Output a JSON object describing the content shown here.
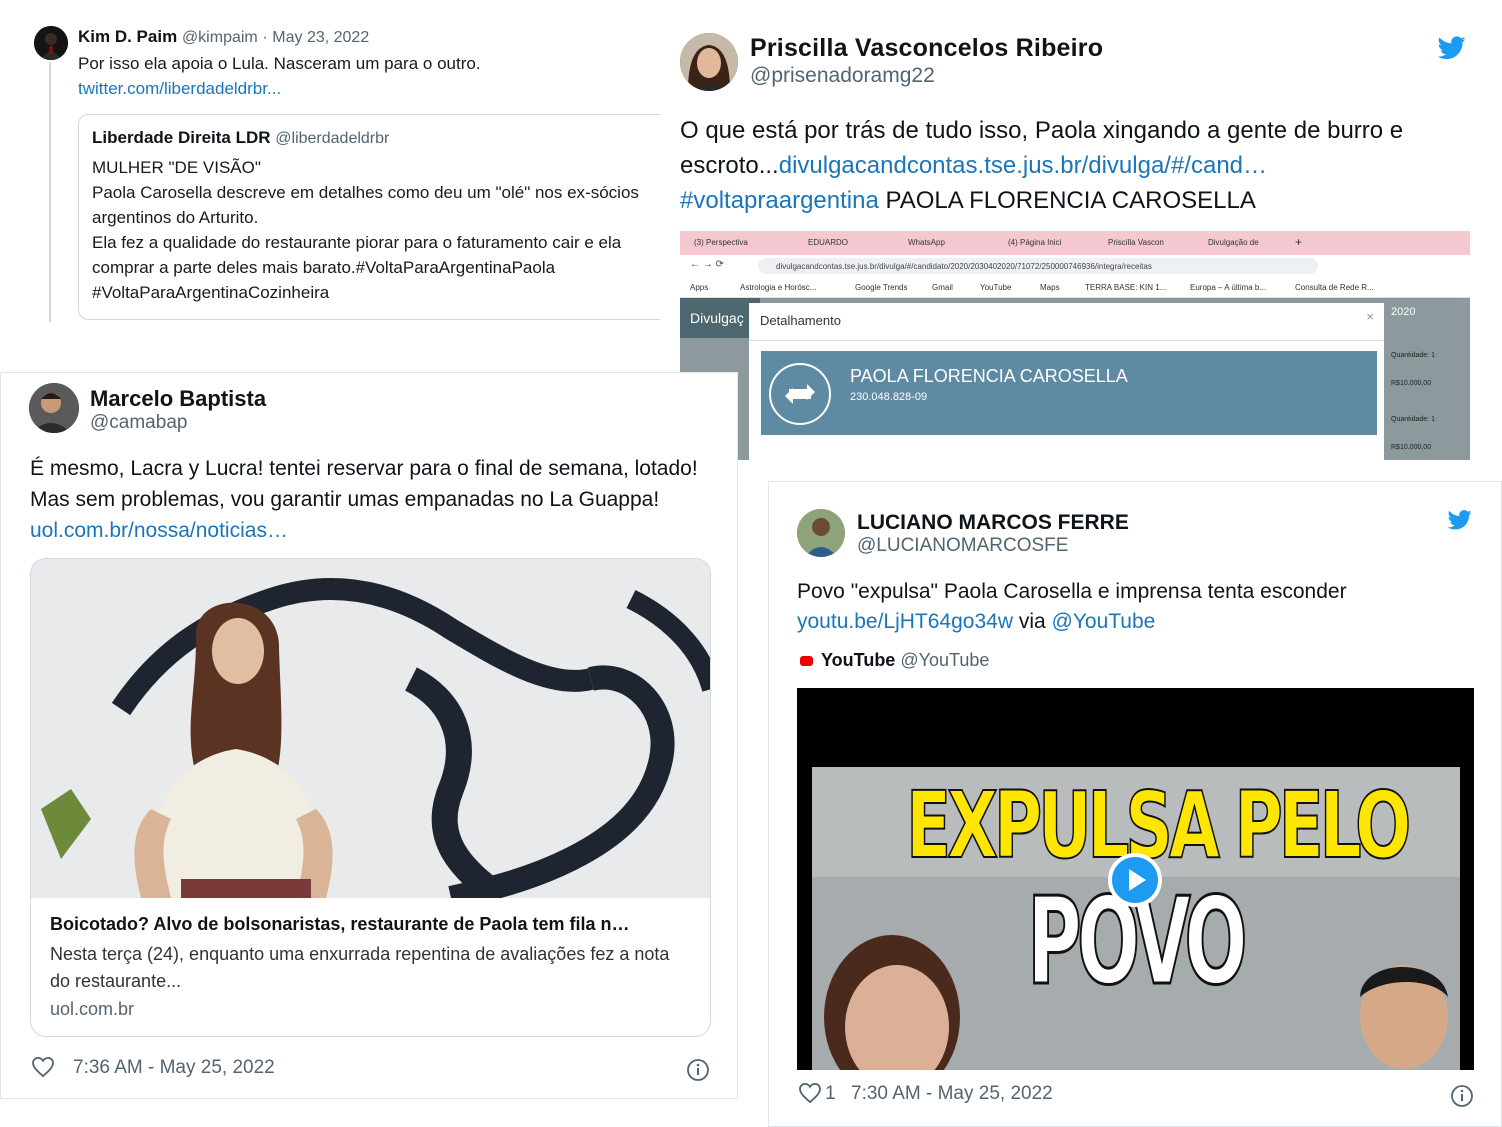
{
  "colors": {
    "link": "#1b75bb",
    "twitter_blue": "#1d9bf0",
    "muted": "#536471",
    "youtube_red": "#ee0000"
  },
  "tweet1": {
    "name": "Kim D. Paim",
    "handle": "@kimpaim",
    "date": "May 23, 2022",
    "text": "Por isso ela apoia o Lula. Nasceram um para o outro.",
    "link": "twitter.com/liberdadeldrbr...",
    "quote": {
      "name": "Liberdade Direita LDR",
      "handle": "@liberdadeldrbr",
      "text": "MULHER \"DE VISÃO\"\nPaola Carosella descreve em detalhes como deu um \"olé\" nos ex-sócios argentinos do Arturito.\nEla fez a qualidade do  restaurante piorar para o faturamento cair e ela comprar a parte deles mais barato.#VoltaParaArgentinaPaola\n#VoltaParaArgentinaCozinheira"
    }
  },
  "tweet2": {
    "name": "Priscilla Vasconcelos Ribeiro",
    "handle": "@prisenadoramg22",
    "text_before": "O que está por trás de tudo isso, Paola xingando a gente de burro e escroto...",
    "link": "divulgacandcontas.tse.jus.br/divulga/#/cand…",
    "hashtag": "#voltapraargentina",
    "text_after": " PAOLA FLORENCIA CAROSELLA",
    "screenshot": {
      "tabs": [
        "(3) Perspectiva",
        "EDUARDO",
        "WhatsApp",
        "(4) Página Inici",
        "Priscilla Vascon",
        "Divulgação de"
      ],
      "url": "divulgacandcontas.tse.jus.br/divulga/#/candidato/2020/2030402020/71072/250000746936/integra/receitas",
      "bookmarks": [
        "Apps",
        "Astrologia e Horósc...",
        "Google Trends",
        "Gmail",
        "YouTube",
        "Maps",
        "TERRA BASE: KIN 1...",
        "Europa – A última b...",
        "Consulta de Rede R..."
      ],
      "site_title": "Divulgaç",
      "modal_title": "Detalhamento",
      "candidate_name": "PAOLA FLORENCIA CAROSELLA",
      "candidate_cpf": "230.048.828-09",
      "side_labels": [
        "2020",
        "Quantidade: 1",
        "R$10.000,00",
        "Quantidade: 1",
        "R$10.000,00"
      ]
    }
  },
  "tweet3": {
    "name": "Marcelo Baptista",
    "handle": "@camabap",
    "text": "É mesmo, Lacra y Lucra! tentei reservar para o final de semana, lotado! Mas sem problemas, vou garantir umas empanadas no La Guappa!",
    "link": "uol.com.br/nossa/noticias…",
    "card": {
      "title": "Boicotado? Alvo de bolsonaristas, restaurante de Paola tem fila n…",
      "description": "Nesta terça (24), enquanto uma enxurrada repentina de avaliações fez a nota do restaurante...",
      "domain": "uol.com.br"
    },
    "time": "7:36 AM - May 25, 2022"
  },
  "tweet4": {
    "name": "LUCIANO MARCOS FERRE",
    "handle": "@LUCIANOMARCOSFE",
    "text": "Povo \"expulsa\" Paola Carosella e imprensa tenta esconder",
    "link": "youtu.be/LjHT64go34w",
    "via": " via ",
    "mention": "@YouTube",
    "embed_name": "YouTube",
    "embed_handle": "@YouTube",
    "video_line1": "EXPULSA PELO",
    "video_line2": "POVO",
    "likes": "1",
    "time": "7:30 AM - May 25, 2022"
  }
}
